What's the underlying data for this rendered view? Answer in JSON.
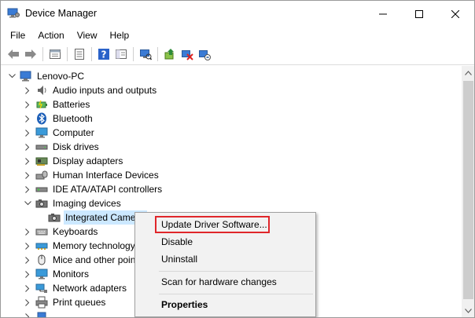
{
  "window": {
    "title": "Device Manager",
    "accent_color": "#e0262a",
    "selection_color": "#cce8ff",
    "controls": [
      "minimize-icon",
      "maximize-icon",
      "close-icon"
    ]
  },
  "menubar": {
    "items": [
      "File",
      "Action",
      "View",
      "Help"
    ]
  },
  "toolbar": {
    "buttons": [
      "back-arrow-icon",
      "forward-arrow-icon",
      "properties-sheet-icon",
      "show-hidden-icon",
      "help-icon",
      "console-tree-icon",
      "scan-hardware-icon",
      "update-driver-icon",
      "disable-device-icon",
      "uninstall-device-icon"
    ]
  },
  "tree": {
    "root": "Lenovo-PC",
    "items": [
      {
        "label": "Audio inputs and outputs",
        "icon": "speaker-icon"
      },
      {
        "label": "Batteries",
        "icon": "battery-icon"
      },
      {
        "label": "Bluetooth",
        "icon": "bluetooth-icon"
      },
      {
        "label": "Computer",
        "icon": "monitor-icon"
      },
      {
        "label": "Disk drives",
        "icon": "disk-drive-icon"
      },
      {
        "label": "Display adapters",
        "icon": "display-adapter-icon"
      },
      {
        "label": "Human Interface Devices",
        "icon": "hid-icon"
      },
      {
        "label": "IDE ATA/ATAPI controllers",
        "icon": "ide-controller-icon"
      },
      {
        "label": "Imaging devices",
        "icon": "camera-icon",
        "expanded": true
      },
      {
        "label": "Integrated Camera",
        "icon": "camera-icon",
        "child": true,
        "selected": true
      },
      {
        "label": "Keyboards",
        "icon": "keyboard-icon"
      },
      {
        "label": "Memory technology devices",
        "icon": "memory-icon"
      },
      {
        "label": "Mice and other pointing devices",
        "icon": "mouse-icon"
      },
      {
        "label": "Monitors",
        "icon": "monitor-icon"
      },
      {
        "label": "Network adapters",
        "icon": "network-adapter-icon"
      },
      {
        "label": "Print queues",
        "icon": "printer-icon"
      }
    ]
  },
  "context_menu": {
    "update": "Update Driver Software...",
    "disable": "Disable",
    "uninstall": "Uninstall",
    "scan": "Scan for hardware changes",
    "properties": "Properties"
  }
}
